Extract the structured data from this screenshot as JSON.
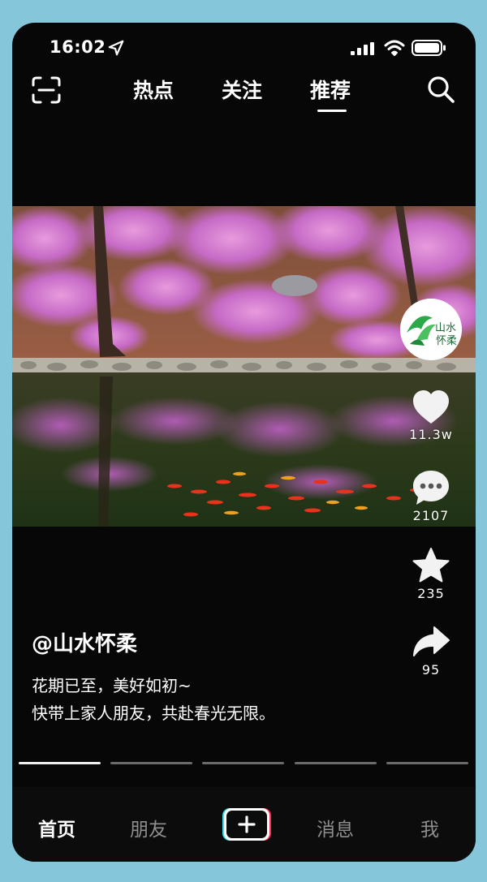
{
  "status_bar": {
    "time": "16:02"
  },
  "top_tabs": [
    "热点",
    "关注",
    "推荐"
  ],
  "active_tab": "推荐",
  "post": {
    "author": "@山水怀柔",
    "caption_line1": "花期已至，美好如初~",
    "caption_line2": "快带上家人朋友，共赴春光无限。",
    "avatar_logo_text": "山水怀柔"
  },
  "actions": {
    "likes": "11.3w",
    "comments": "2107",
    "favorites": "235",
    "shares": "95"
  },
  "progress": {
    "segments": 5,
    "active_index": 0
  },
  "bottom_nav": {
    "home": "首页",
    "friends": "朋友",
    "messages": "消息",
    "me": "我"
  },
  "colors": {
    "background": "#86c6da",
    "phone": "#070707",
    "plus_cyan": "#39e6f0",
    "plus_red": "#ff2d55"
  }
}
